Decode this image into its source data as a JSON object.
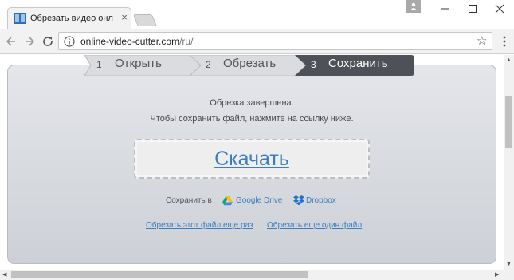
{
  "browser": {
    "tab_title": "Обрезать видео онлайн",
    "url_host": "online-video-cutter.com",
    "url_path": "/ru/"
  },
  "steps": [
    {
      "num": "1",
      "label": "Открыть"
    },
    {
      "num": "2",
      "label": "Обрезать"
    },
    {
      "num": "3",
      "label": "Сохранить"
    }
  ],
  "message": {
    "line1": "Обрезка завершена.",
    "line2": "Чтобы сохранить файл, нажмите на ссылку ниже."
  },
  "download_label": "Скачать",
  "save_to": {
    "label": "Сохранить в",
    "google_drive": "Google Drive",
    "dropbox": "Dropbox"
  },
  "links": {
    "again": "Обрезать этот файл еще раз",
    "other": "Обрезать еще один файл"
  },
  "colors": {
    "link": "#3a7ec0",
    "step_active": "#4e5258",
    "step_inactive": "#d8dade",
    "panel": "#d8dade"
  },
  "icons": {
    "favicon": "film-strip-icon",
    "info": "info-icon",
    "star": "star-icon",
    "gdrive": "google-drive-icon",
    "dropbox": "dropbox-icon"
  }
}
